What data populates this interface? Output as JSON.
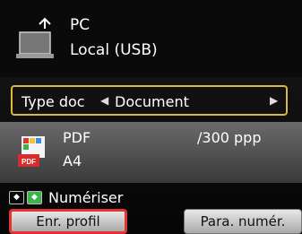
{
  "destination": {
    "line1": "PC",
    "line2": "Local (USB)",
    "icon": "laptop-icon"
  },
  "doc_type": {
    "label": "Type doc",
    "value": "Document",
    "prev_icon": "triangle-left-icon",
    "next_icon": "triangle-right-icon"
  },
  "settings": {
    "format": "PDF",
    "resolution": "/300 ppp",
    "size": "A4",
    "file_icon": "pdf-file-icon"
  },
  "start_hint": {
    "text": "Numériser",
    "icons": [
      "black-start-icon",
      "color-start-icon"
    ]
  },
  "buttons": {
    "left": "Enr. profil",
    "right": "Para. numér."
  },
  "colors": {
    "focus_border": "#e2b53c",
    "left_button_border": "#e53232",
    "color_start": "#3bb54a"
  }
}
